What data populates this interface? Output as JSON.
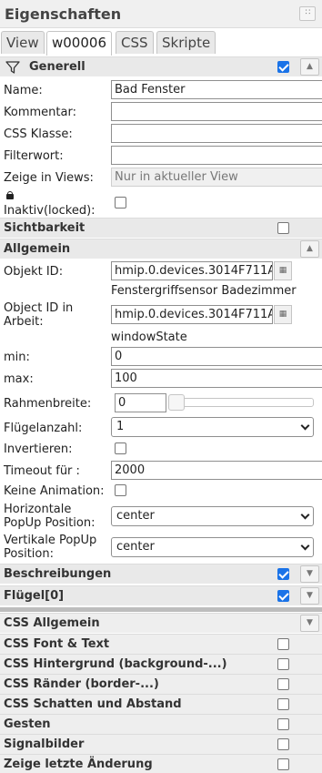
{
  "header": {
    "title": "Eigenschaften",
    "menu_glyph": "∷"
  },
  "tabs": [
    "View",
    "w00006",
    "CSS",
    "Skripte"
  ],
  "generell": {
    "title": "Generell",
    "checked": true,
    "name_label": "Name:",
    "name_value": "Bad Fenster",
    "comment_label": "Kommentar:",
    "comment_value": "",
    "css_class_label": "CSS Klasse:",
    "css_class_value": "",
    "filter_label": "Filterwort:",
    "filter_value": "",
    "views_label": "Zeige in Views:",
    "views_value": "Nur in aktueller View",
    "locked_label": "Inaktiv(locked):",
    "locked_checked": false
  },
  "sichtbarkeit": {
    "title": "Sichtbarkeit",
    "checked": false
  },
  "allgemein": {
    "title": "Allgemein",
    "objekt_id_label": "Objekt ID:",
    "objekt_id_value": "hmip.0.devices.3014F711A",
    "objekt_id_name": "Fenstergriffsensor Badezimmer",
    "work_id_label": "Object ID in Arbeit:",
    "work_id_value": "hmip.0.devices.3014F711A",
    "work_id_name": "windowState",
    "min_label": "min:",
    "min_value": "0",
    "max_label": "max:",
    "max_value": "100",
    "rahmen_label": "Rahmenbreite:",
    "rahmen_value": "0",
    "fluegel_label": "Flügelanzahl:",
    "fluegel_value": "1",
    "invert_label": "Invertieren:",
    "invert_checked": false,
    "timeout_label": "Timeout für :",
    "timeout_value": "2000",
    "noanim_label": "Keine Animation:",
    "noanim_checked": false,
    "hpopup_label": "Horizontale PopUp Position:",
    "hpopup_value": "center",
    "vpopup_label": "Vertikale PopUp Position:",
    "vpopup_value": "center"
  },
  "beschreibungen": {
    "title": "Beschreibungen",
    "checked": true
  },
  "fluegel0": {
    "title": "Flügel[0]",
    "checked": true
  },
  "css_sections": [
    {
      "title": "CSS Allgemein"
    },
    {
      "title": "CSS Font & Text",
      "checked": false
    },
    {
      "title": "CSS Hintergrund (background-...)",
      "checked": false
    },
    {
      "title": "CSS Ränder (border-...)",
      "checked": false
    },
    {
      "title": "CSS Schatten und Abstand",
      "checked": false
    },
    {
      "title": "Gesten",
      "checked": false
    },
    {
      "title": "Signalbilder",
      "checked": false
    },
    {
      "title": "Zeige letzte Änderung",
      "checked": false
    }
  ],
  "colors": {
    "accent": "#1a73e8",
    "header_bg": "#f0f0f0",
    "section_bg": "#e9e9e9"
  },
  "icons": {
    "filter": "funnel-icon",
    "lock": "lock-icon",
    "collapse": "chevron-up-icon",
    "expand": "chevron-down-icon",
    "id_select": "object-browser-icon"
  }
}
